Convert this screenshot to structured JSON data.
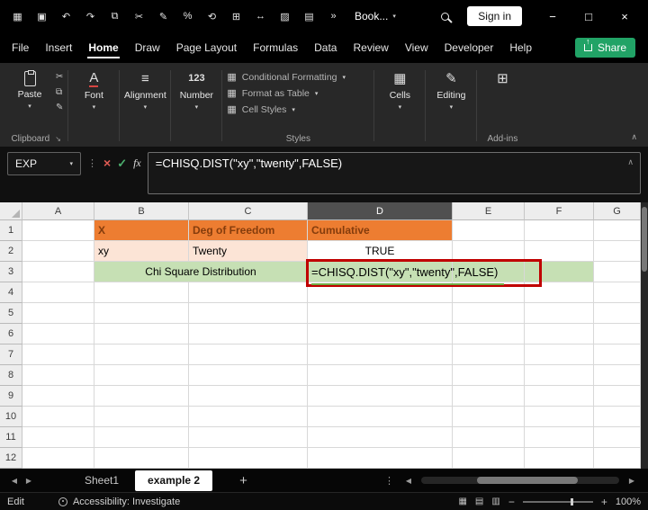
{
  "colors": {
    "accent_green": "#21A366",
    "header_orange": "#ED7D31",
    "header_orange_text": "#843C0C",
    "peach_fill": "#FCE4D6",
    "green_fill": "#C6E0B4",
    "annotation_red": "#C00000",
    "selected_header_bg": "#505050"
  },
  "titlebar": {
    "document_name": "Book...",
    "signin_label": "Sign in",
    "icons": [
      {
        "name": "app-launcher-icon",
        "glyph": "▦"
      },
      {
        "name": "save-icon",
        "glyph": "▣"
      },
      {
        "name": "undo-icon",
        "glyph": "↶"
      },
      {
        "name": "redo-icon",
        "glyph": "↷"
      },
      {
        "name": "copy-icon",
        "glyph": "⧉"
      },
      {
        "name": "cut-icon",
        "glyph": "✂"
      },
      {
        "name": "format-painter-icon",
        "glyph": "✎"
      },
      {
        "name": "percent-style-icon",
        "glyph": "%"
      },
      {
        "name": "undo-history-icon",
        "glyph": "⟲"
      },
      {
        "name": "borders-icon",
        "glyph": "⊞"
      },
      {
        "name": "merge-center-icon",
        "glyph": "↔"
      },
      {
        "name": "fill-color-icon",
        "glyph": "▨"
      },
      {
        "name": "freeze-panes-icon",
        "glyph": "▤"
      },
      {
        "name": "overflow-icon",
        "glyph": "»"
      }
    ]
  },
  "menubar": {
    "items": [
      "File",
      "Insert",
      "Home",
      "Draw",
      "Page Layout",
      "Formulas",
      "Data",
      "Review",
      "View",
      "Developer",
      "Help"
    ],
    "active": "Home",
    "share_label": "Share"
  },
  "ribbon": {
    "paste_label": "Paste",
    "clipboard_group_label": "Clipboard",
    "font_label": "Font",
    "alignment_label": "Alignment",
    "number_label": "Number",
    "styles_items": [
      "Conditional Formatting",
      "Format as Table",
      "Cell Styles"
    ],
    "styles_group_label": "Styles",
    "cells_label": "Cells",
    "editing_label": "Editing",
    "addins_group_label": "Add-ins"
  },
  "formula_bar": {
    "name_box_value": "EXP",
    "formula": "=CHISQ.DIST(\"xy\",\"twenty\",FALSE)"
  },
  "grid": {
    "column_headers": [
      "A",
      "B",
      "C",
      "D",
      "E",
      "F",
      "G"
    ],
    "row_headers": [
      "1",
      "2",
      "3",
      "4",
      "5",
      "6",
      "7",
      "8",
      "9",
      "10",
      "11",
      "12"
    ],
    "selected_column": "D",
    "cells": [
      {
        "ref": "B1",
        "text": "X",
        "style": "orange"
      },
      {
        "ref": "C1",
        "text": "Deg of Freedom",
        "style": "orange"
      },
      {
        "ref": "D1",
        "text": "Cumulative",
        "style": "orange"
      },
      {
        "ref": "B2",
        "text": "xy",
        "style": "peach"
      },
      {
        "ref": "C2",
        "text": "Twenty",
        "style": "peach"
      },
      {
        "ref": "D2",
        "text": "TRUE",
        "style": "center"
      },
      {
        "ref": "B3",
        "text": "Chi Square Distribution",
        "style": "green center",
        "colspan": 2
      },
      {
        "ref": "D3",
        "text": "=CHISQ.DIST(\"xy\",\"twenty\",FALSE)",
        "style": "green edit"
      },
      {
        "ref": "E3",
        "text": "",
        "style": "green"
      },
      {
        "ref": "F3",
        "text": "",
        "style": "green"
      }
    ]
  },
  "sheet_tabs": {
    "tabs": [
      {
        "label": "Sheet1",
        "active": false
      },
      {
        "label": "example 2",
        "active": true
      }
    ],
    "add_sheet_label": "+"
  },
  "status_bar": {
    "mode": "Edit",
    "accessibility_label": "Accessibility: Investigate",
    "zoom_level": "100%"
  }
}
